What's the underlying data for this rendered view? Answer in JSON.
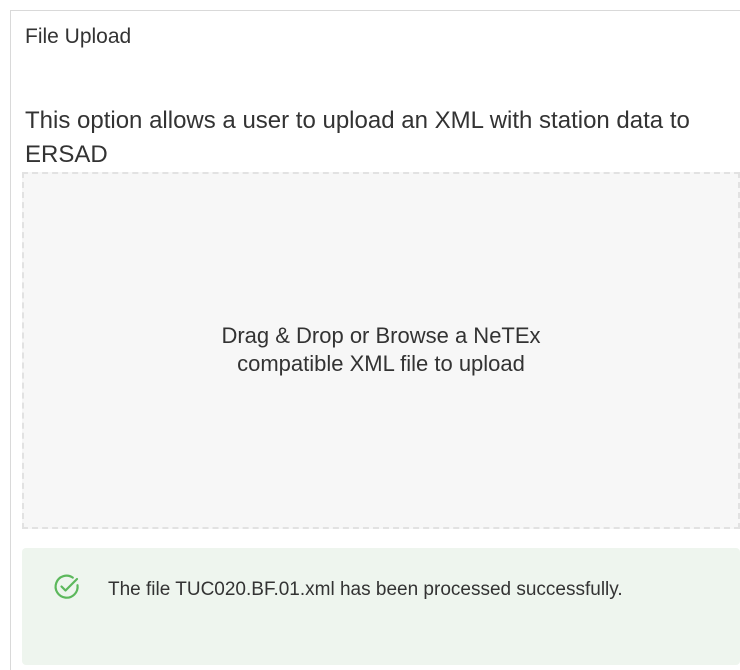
{
  "panel": {
    "title": "File Upload",
    "description": "This option allows a user to upload an XML with station data to ERSAD"
  },
  "dropzone": {
    "line1": "Drag & Drop or Browse a NeTEx",
    "line2": "compatible XML file to upload"
  },
  "alert": {
    "icon": "check-circle-icon",
    "message": "The file TUC020.BF.01.xml has been processed successfully.",
    "color": "#5cb85c",
    "background": "#eef5ee"
  }
}
